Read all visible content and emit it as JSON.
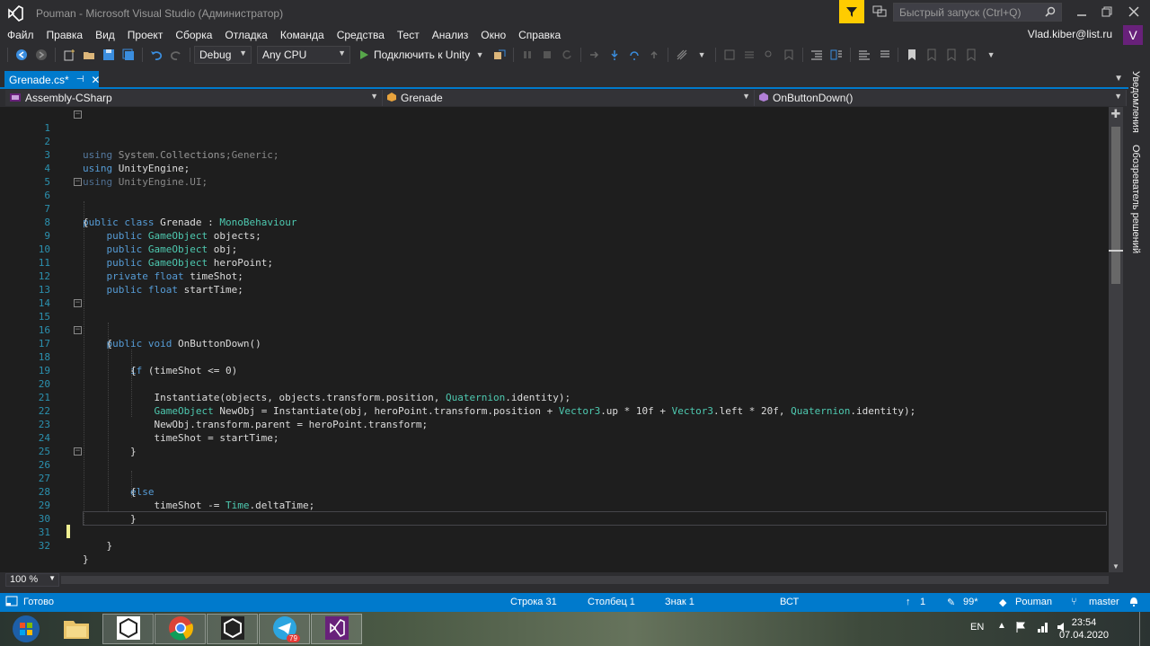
{
  "window": {
    "title": "Pouman - Microsoft Visual Studio  (Администратор)",
    "quick_launch_placeholder": "Быстрый запуск (Ctrl+Q)"
  },
  "menu": [
    "Файл",
    "Правка",
    "Вид",
    "Проект",
    "Сборка",
    "Отладка",
    "Команда",
    "Средства",
    "Тест",
    "Анализ",
    "Окно",
    "Справка"
  ],
  "account": {
    "user": "Vlad.kiber@list.ru",
    "avatar_letter": "V"
  },
  "toolbar": {
    "configuration": "Debug",
    "platform": "Any CPU",
    "run_label": "Подключить к Unity"
  },
  "tab": {
    "label": "Grenade.cs*"
  },
  "navbar": {
    "project": "Assembly-CSharp",
    "class": "Grenade",
    "member": "OnButtonDown()"
  },
  "code": [
    "using System.Collections;",
    "using System.Collections.Generic;",
    "using UnityEngine;",
    "using UnityEngine.UI;",
    "",
    "public class Grenade : MonoBehaviour",
    "{",
    "    public GameObject objects;",
    "    public GameObject obj;",
    "    public GameObject heroPoint;",
    "    private float timeShot;",
    "    public float startTime;",
    "",
    "",
    "    public void OnButtonDown()",
    "    {",
    "        if (timeShot <= 0)",
    "        {",
    "",
    "            Instantiate(objects, objects.transform.position, Quaternion.identity);",
    "            GameObject NewObj = Instantiate(obj, heroPoint.transform.position + Vector3.up * 10f + Vector3.left * 20f, Quaternion.identity);",
    "            NewObj.transform.parent = heroPoint.transform;",
    "            timeShot = startTime;",
    "        }",
    "",
    "        else",
    "        {",
    "            timeShot -= Time.deltaTime;",
    "        }",
    "",
    "    }",
    "}"
  ],
  "line_numbers": [
    "1",
    "2",
    "3",
    "4",
    "5",
    "6",
    "7",
    "8",
    "9",
    "10",
    "11",
    "12",
    "13",
    "14",
    "15",
    "16",
    "17",
    "18",
    "19",
    "20",
    "21",
    "22",
    "23",
    "24",
    "25",
    "26",
    "27",
    "28",
    "29",
    "30",
    "31",
    "32"
  ],
  "editor": {
    "zoom": "100 %"
  },
  "side_tabs": [
    "Уведомления",
    "Обозреватель решений"
  ],
  "status": {
    "ready": "Готово",
    "line": "Строка 31",
    "column": "Столбец 1",
    "char": "Знак 1",
    "mode": "ВСТ",
    "publish_count": "1",
    "pending": "99*",
    "repo": "Pouman",
    "branch": "master"
  },
  "taskbar": {
    "lang": "EN",
    "time": "23:54",
    "date": "07.04.2020",
    "telegram_badge": "79"
  },
  "colors": {
    "accent": "#007acc",
    "keyword": "#569cd6",
    "type": "#4ec9b0",
    "line_number": "#2b91af",
    "filter": "#ffcc00",
    "avatar": "#68217a"
  }
}
